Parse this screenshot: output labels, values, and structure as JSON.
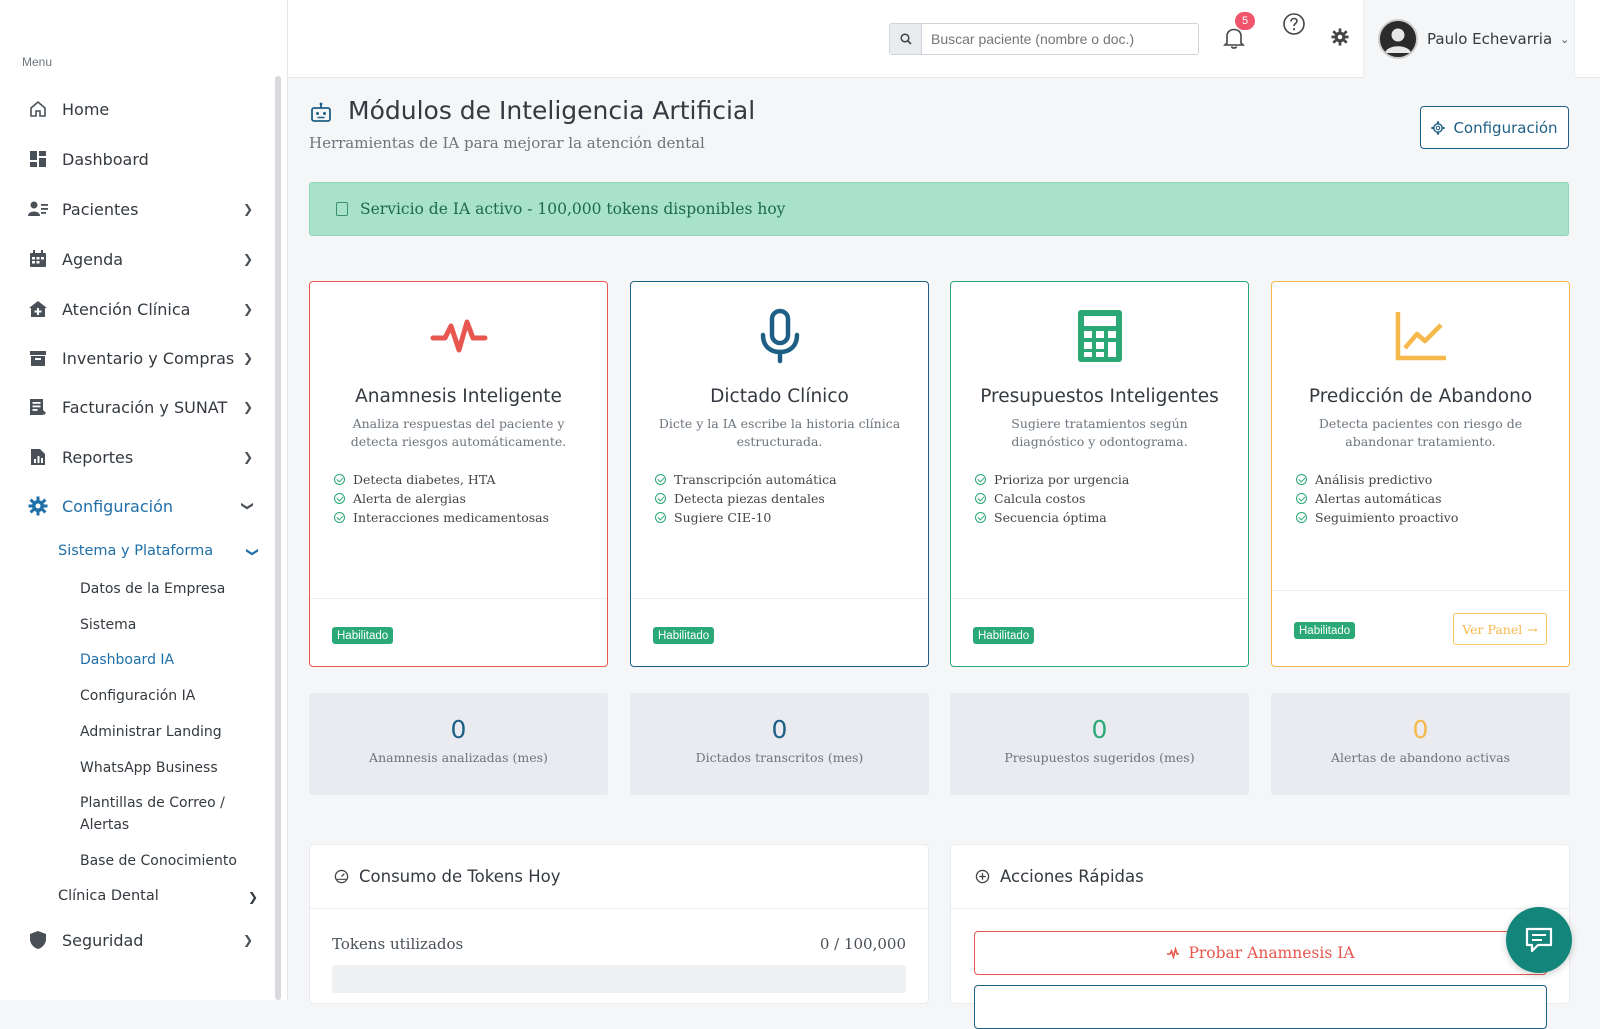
{
  "sidebar": {
    "menu_title": "Menu",
    "items": [
      {
        "label": "Home",
        "icon": "home-icon"
      },
      {
        "label": "Dashboard",
        "icon": "dashboard-icon"
      },
      {
        "label": "Pacientes",
        "icon": "patients-icon"
      },
      {
        "label": "Agenda",
        "icon": "calendar-icon"
      },
      {
        "label": "Atención Clínica",
        "icon": "clinic-icon"
      },
      {
        "label": "Inventario y Compras",
        "icon": "archive-icon"
      },
      {
        "label": "Facturación y SUNAT",
        "icon": "invoice-icon"
      },
      {
        "label": "Reportes",
        "icon": "report-icon"
      },
      {
        "label": "Configuración",
        "icon": "gear-icon"
      },
      {
        "label": "Seguridad",
        "icon": "shield-icon"
      }
    ],
    "sub_system": "Sistema y Plataforma",
    "sub_items": [
      "Datos de la Empresa",
      "Sistema",
      "Dashboard IA",
      "Configuración IA",
      "Administrar Landing",
      "WhatsApp Business",
      "Plantillas de Correo /",
      "Alertas",
      "Base de Conocimiento"
    ],
    "sub_clinic": "Clínica Dental"
  },
  "topbar": {
    "search_placeholder": "Buscar paciente (nombre o doc.)",
    "notifications_count": "5",
    "user_name": "Paulo Echevarria"
  },
  "page": {
    "title": "Módulos de Inteligencia Artificial",
    "subtitle": "Herramientas de IA para mejorar la atención dental",
    "config_button": "Configuración",
    "alert": "Servicio de IA activo - 100,000 tokens disponibles hoy"
  },
  "cards": [
    {
      "title": "Anamnesis Inteligente",
      "desc": "Analiza respuestas del paciente y detecta riesgos automáticamente.",
      "features": [
        "Detecta diabetes, HTA",
        "Alerta de alergias",
        "Interacciones medicamentosas"
      ],
      "badge": "Habilitado",
      "color": "#e8574f",
      "icon": "pulse-icon"
    },
    {
      "title": "Dictado Clínico",
      "desc": "Dicte y la IA escribe la historia clínica estructurada.",
      "features": [
        "Transcripción automática",
        "Detecta piezas dentales",
        "Sugiere CIE-10"
      ],
      "badge": "Habilitado",
      "color": "#1f5f85",
      "icon": "microphone-icon"
    },
    {
      "title": "Presupuestos Inteligentes",
      "desc": "Sugiere tratamientos según diagnóstico y odontograma.",
      "features": [
        "Prioriza por urgencia",
        "Calcula costos",
        "Secuencia óptima"
      ],
      "badge": "Habilitado",
      "color": "#2aa876",
      "icon": "calculator-icon"
    },
    {
      "title": "Predicción de Abandono",
      "desc": "Detecta pacientes con riesgo de abandonar tratamiento.",
      "features": [
        "Análisis predictivo",
        "Alertas automáticas",
        "Seguimiento proactivo"
      ],
      "badge": "Habilitado",
      "color": "#f7b84b",
      "icon": "chart-line-icon",
      "button": "Ver Panel"
    }
  ],
  "stats": [
    {
      "value": "0",
      "label": "Anamnesis analizadas (mes)",
      "color": "#1f5f85"
    },
    {
      "value": "0",
      "label": "Dictados transcritos (mes)",
      "color": "#1f5f85"
    },
    {
      "value": "0",
      "label": "Presupuestos sugeridos (mes)",
      "color": "#2aa876"
    },
    {
      "value": "0",
      "label": "Alertas de abandono activas",
      "color": "#f7b84b"
    }
  ],
  "tokens": {
    "title": "Consumo de Tokens Hoy",
    "label": "Tokens utilizados",
    "value": "0 / 100,000",
    "used_fraction": 0
  },
  "quick_actions": {
    "title": "Acciones Rápidas",
    "buttons": [
      "Probar Anamnesis IA"
    ]
  }
}
